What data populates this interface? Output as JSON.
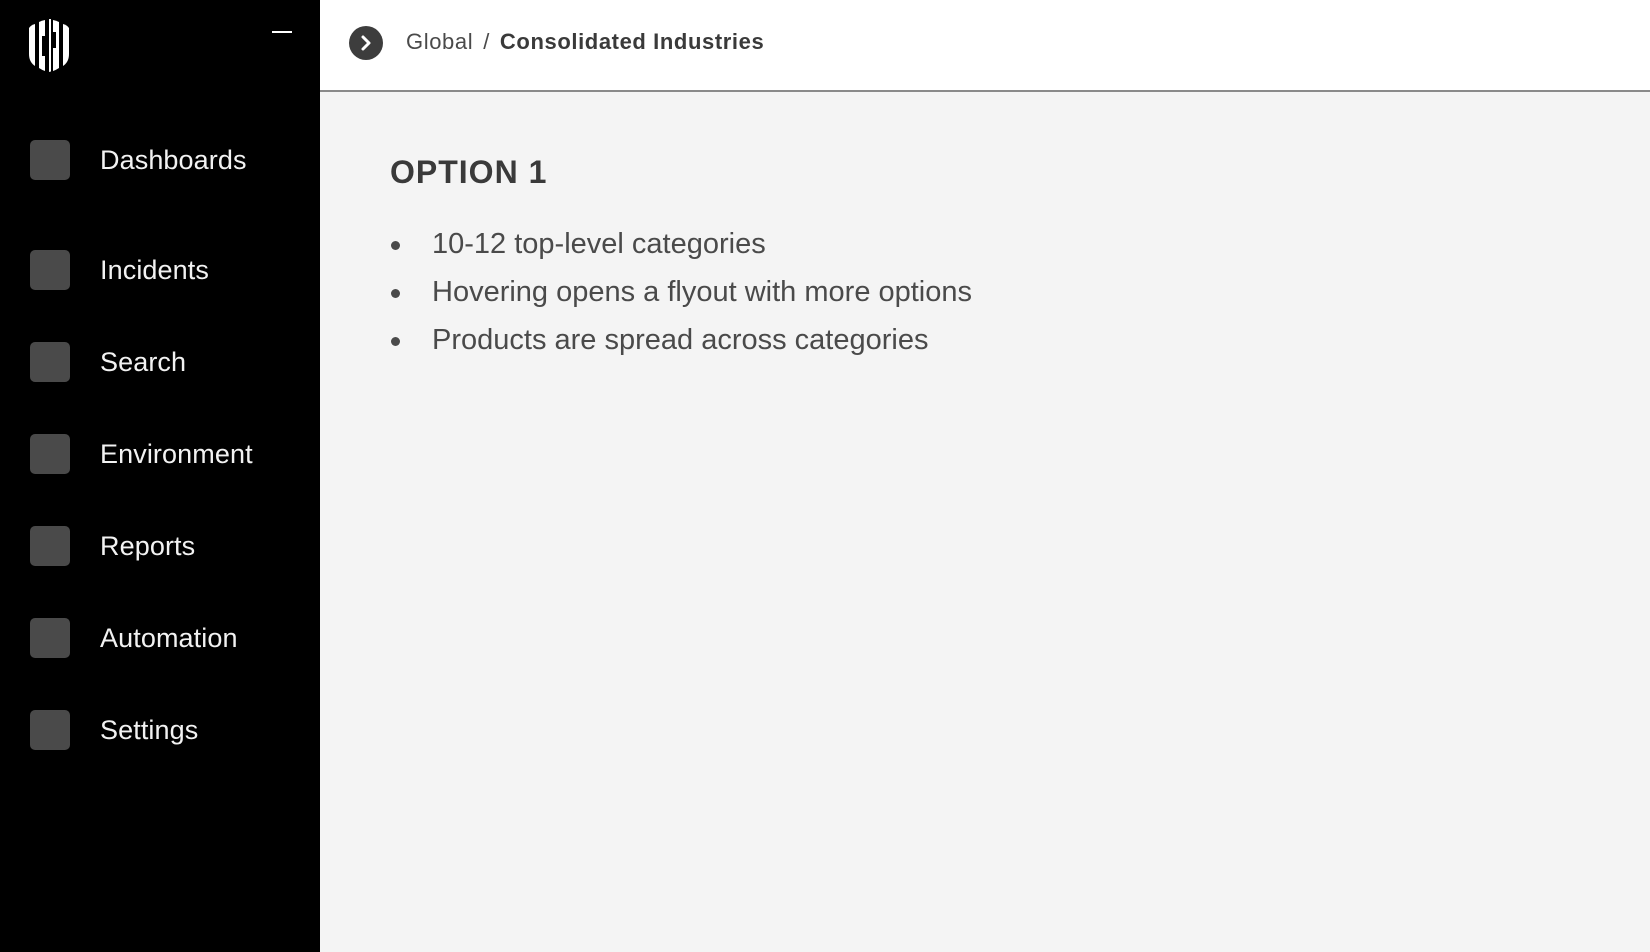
{
  "sidebar": {
    "logo_icon": "striped-shield-logo",
    "collapse_icon": "minus-icon",
    "items": [
      {
        "label": "Dashboards",
        "icon": "placeholder-square-icon"
      },
      {
        "label": "Incidents",
        "icon": "placeholder-square-icon"
      },
      {
        "label": "Search",
        "icon": "placeholder-square-icon"
      },
      {
        "label": "Environment",
        "icon": "placeholder-square-icon"
      },
      {
        "label": "Reports",
        "icon": "placeholder-square-icon"
      },
      {
        "label": "Automation",
        "icon": "placeholder-square-icon"
      },
      {
        "label": "Settings",
        "icon": "placeholder-square-icon"
      }
    ]
  },
  "header": {
    "expand_icon": "chevron-right-icon",
    "breadcrumb": {
      "root": "Global",
      "separator": "/",
      "current": "Consolidated Industries"
    }
  },
  "main": {
    "title": "OPTION 1",
    "bullets": [
      "10-12 top-level categories",
      "Hovering opens a flyout with more options",
      "Products are spread across categories"
    ]
  },
  "colors": {
    "sidebar_bg": "#000000",
    "nav_icon": "#4a4a4a",
    "main_bg": "#f4f4f4",
    "header_bg": "#ffffff",
    "text": "#4a4a4a"
  }
}
